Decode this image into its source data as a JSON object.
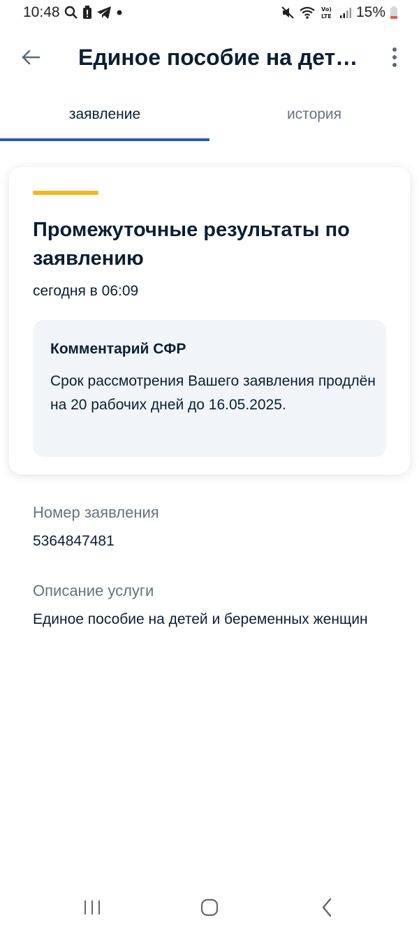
{
  "status_bar": {
    "time": "10:48",
    "battery": "15%"
  },
  "header": {
    "title": "Единое пособие на дет…"
  },
  "tabs": [
    {
      "label": "заявление",
      "active": true
    },
    {
      "label": "история",
      "active": false
    }
  ],
  "card": {
    "title": "Промежуточные результаты по заявлению",
    "date": "сегодня в 06:09",
    "comment_title": "Комментарий СФР",
    "comment_text": "Срок рассмотрения Вашего заявления продлён на 20 рабочих дней до 16.05.2025."
  },
  "fields": [
    {
      "label": "Номер заявления",
      "value": "5364847481"
    },
    {
      "label": "Описание услуги",
      "value": "Единое пособие на детей и беременных женщин"
    }
  ],
  "colors": {
    "accent_yellow": "#f2b91f",
    "tab_underline": "#2a5ea8",
    "comment_bg": "#f1f4f9",
    "label_gray": "#66727f"
  }
}
